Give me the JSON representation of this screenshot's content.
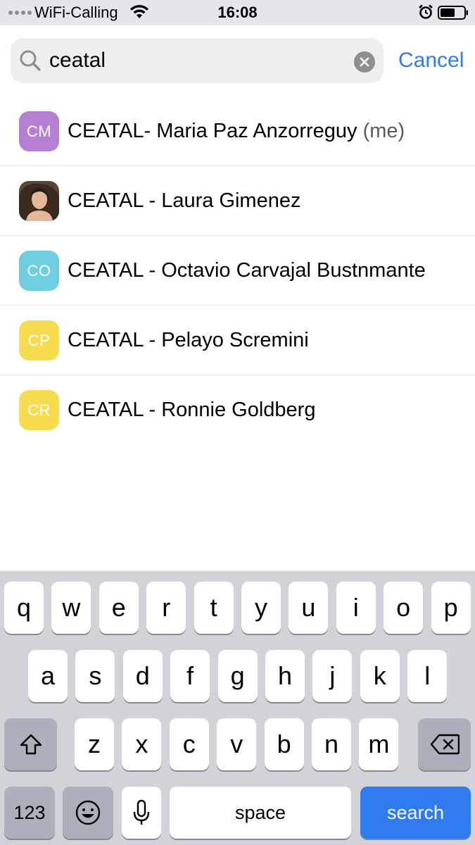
{
  "status_bar": {
    "carrier": "WiFi-Calling",
    "time": "16:08"
  },
  "search": {
    "value": "ceatal",
    "cancel_label": "Cancel"
  },
  "results": [
    {
      "initials": "CM",
      "color": "#b77fd3",
      "name": "CEATAL- Maria Paz Anzorreguy",
      "suffix": " (me)",
      "photo": false
    },
    {
      "initials": "",
      "color": "#4a3a30",
      "name": "CEATAL - Laura Gimenez",
      "suffix": "",
      "photo": true
    },
    {
      "initials": "CO",
      "color": "#6fcde0",
      "name": "CEATAL - Octavio Carvajal Bustnmante",
      "suffix": "",
      "photo": false
    },
    {
      "initials": "CP",
      "color": "#f7dc4f",
      "name": "CEATAL - Pelayo Scremini",
      "suffix": "",
      "photo": false
    },
    {
      "initials": "CR",
      "color": "#f7dc4f",
      "name": "CEATAL - Ronnie Goldberg",
      "suffix": "",
      "photo": false
    }
  ],
  "keyboard": {
    "row1": [
      "q",
      "w",
      "e",
      "r",
      "t",
      "y",
      "u",
      "i",
      "o",
      "p"
    ],
    "row2": [
      "a",
      "s",
      "d",
      "f",
      "g",
      "h",
      "j",
      "k",
      "l"
    ],
    "row3": [
      "z",
      "x",
      "c",
      "v",
      "b",
      "n",
      "m"
    ],
    "numbers_label": "123",
    "space_label": "space",
    "search_label": "search",
    "shift_icon": "shift-icon",
    "delete_icon": "delete-icon",
    "emoji_icon": "emoji-icon",
    "mic_icon": "microphone-icon"
  },
  "colors": {
    "accent": "#2f7bf0"
  }
}
